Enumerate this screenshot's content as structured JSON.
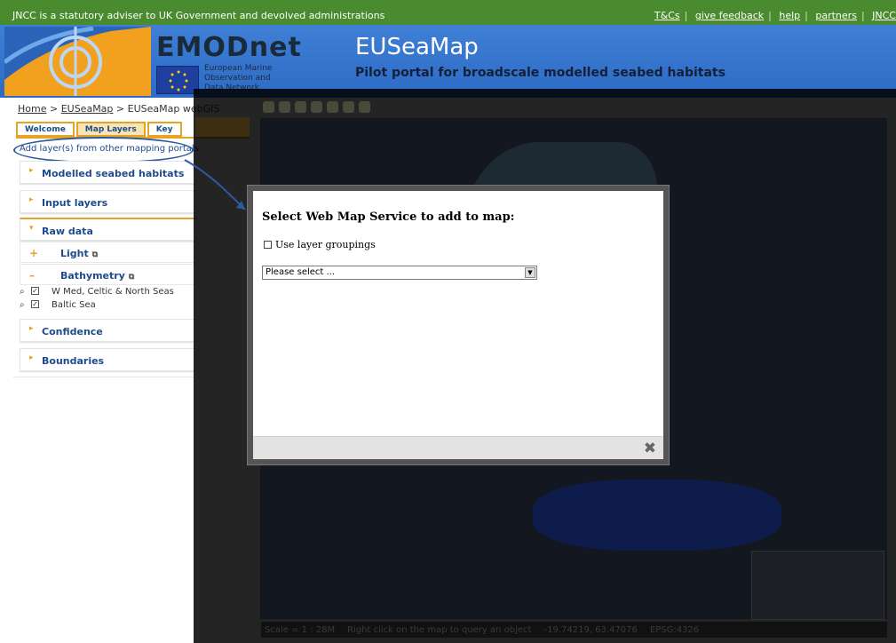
{
  "topbar": {
    "message": "JNCC is a statutory adviser to UK Government and devolved administrations",
    "links": [
      "T&Cs",
      "give feedback",
      "help",
      "partners",
      "JNCC"
    ]
  },
  "header": {
    "brand_title": "EMODnet",
    "brand_subtitle": "European Marine Observation and Data Network",
    "site_title": "EUSeaMap",
    "site_subtitle": "Pilot portal for broadscale modelled seabed habitats"
  },
  "breadcrumb": {
    "home": "Home",
    "sep": " > ",
    "section": "EUSeaMap",
    "current": "EUSeaMap webGIS"
  },
  "tabs": [
    {
      "label": "Welcome"
    },
    {
      "label": "Map Layers"
    },
    {
      "label": "Key"
    }
  ],
  "add_layer_link": "Add layer(s) from other mapping portals",
  "panels": {
    "modelled": "Modelled seabed habitats",
    "input": "Input layers",
    "raw": "Raw data",
    "confidence": "Confidence",
    "boundaries": "Boundaries"
  },
  "subpanels": {
    "light": {
      "symbol": "+",
      "label": "Light"
    },
    "bathymetry": {
      "symbol": "–",
      "label": "Bathymetry"
    }
  },
  "bathymetry_layers": [
    {
      "name": "W Med, Celtic & North Seas",
      "checked": true
    },
    {
      "name": "Baltic Sea",
      "checked": true
    }
  ],
  "status_bar": {
    "scale": "Scale = 1 : 28M",
    "hint": "Right click on the map to query an object",
    "coords": "-19.74219, 63.47076",
    "epsg": "EPSG:4326"
  },
  "dialog": {
    "title": "Select Web Map Service to add to map:",
    "checkbox_label": "Use layer groupings",
    "select_placeholder": "Please select ...",
    "close_symbol": "✖"
  },
  "colors": {
    "accent": "#e6a326",
    "link": "#1e4b8c",
    "topbar": "#4b8b2f",
    "header": "#3f7fd6"
  }
}
